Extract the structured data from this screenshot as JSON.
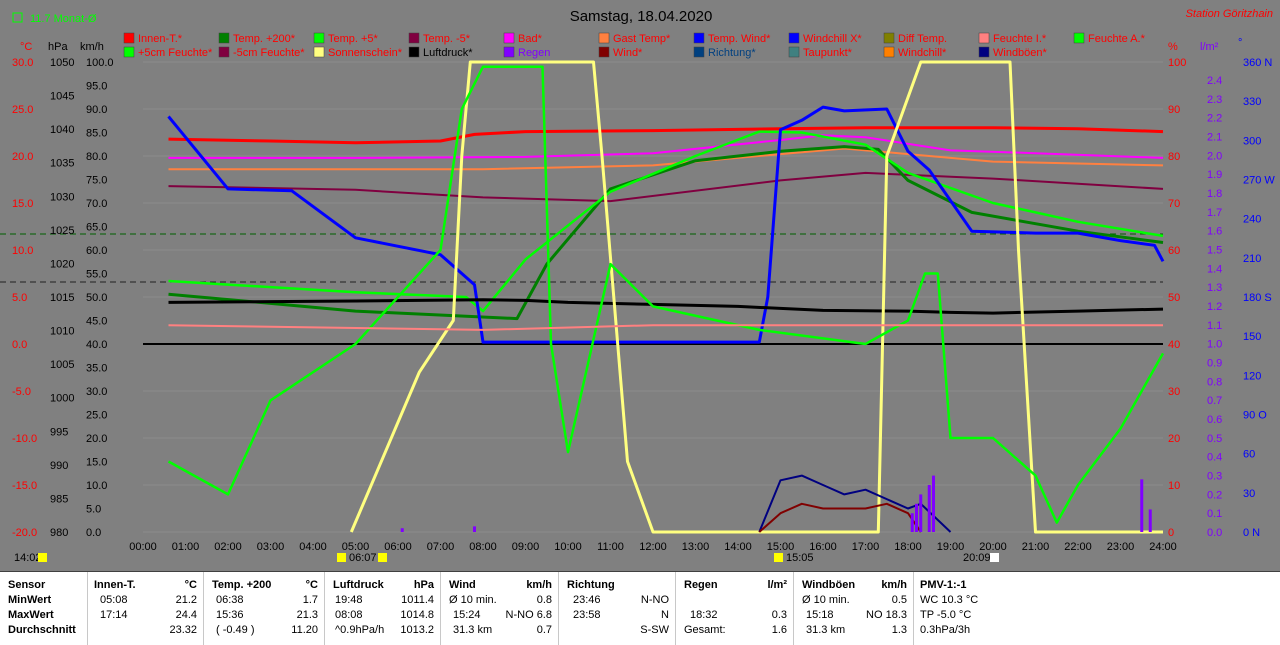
{
  "header": {
    "title": "Samstag, 18.04.2020",
    "station": "Station Göritzhain",
    "monat": "11.7 Monat-Ø"
  },
  "colors": {
    "background": "#808080",
    "innen": "#ff0000",
    "temp200": "#008000",
    "temp5": "#00ff00",
    "tempm5": "#800040",
    "bad": "#ff00ff",
    "gast": "#ff8040",
    "wind": "#0000ff",
    "luftdruck": "#000000",
    "sonne": "#ffff80",
    "regen": "#8000ff",
    "feuchteI": "#ff8080",
    "diff": "#808000",
    "taupunkt": "#408080"
  },
  "legend": [
    {
      "label": "Innen-T.*",
      "color": "#ff0000",
      "text_color": "#ff0000"
    },
    {
      "label": "Temp. +200*",
      "color": "#008000",
      "text_color": "#ff0000"
    },
    {
      "label": "Temp. +5*",
      "color": "#00ff00",
      "text_color": "#ff0000"
    },
    {
      "label": "Temp. -5*",
      "color": "#800040",
      "text_color": "#ff0000"
    },
    {
      "label": "Bad*",
      "color": "#ff00ff",
      "text_color": "#ff0000"
    },
    {
      "label": "Gast Temp*",
      "color": "#ff8040",
      "text_color": "#ff0000"
    },
    {
      "label": "Temp. Wind*",
      "color": "#0000ff",
      "text_color": "#ff0000"
    },
    {
      "label": "Windchill X*",
      "color": "#0000ff",
      "text_color": "#ff0000"
    },
    {
      "label": "Diff Temp.",
      "color": "#808000",
      "text_color": "#ff0000"
    },
    {
      "label": "Feuchte I.*",
      "color": "#ff8080",
      "text_color": "#ff0000"
    },
    {
      "label": "Feuchte A.*",
      "color": "#00ff00",
      "text_color": "#ff0000"
    },
    {
      "label": "+5cm Feuchte*",
      "color": "#00ff00",
      "text_color": "#ff0000"
    },
    {
      "label": "-5cm Feuchte*",
      "color": "#800040",
      "text_color": "#ff0000"
    },
    {
      "label": "Sonnenschein*",
      "color": "#ffff80",
      "text_color": "#ff0000"
    },
    {
      "label": "Luftdruck*",
      "color": "#000000",
      "text_color": "#000000"
    },
    {
      "label": "Regen",
      "color": "#8000ff",
      "text_color": "#8000ff"
    },
    {
      "label": "Wind*",
      "color": "#800000",
      "text_color": "#ff0000"
    },
    {
      "label": "Richtung*",
      "color": "#004080",
      "text_color": "#004080"
    },
    {
      "label": "Taupunkt*",
      "color": "#408080",
      "text_color": "#ff0000"
    },
    {
      "label": "Windchill*",
      "color": "#ff8000",
      "text_color": "#ff0000"
    },
    {
      "label": "Windböen*",
      "color": "#000080",
      "text_color": "#ff0000"
    }
  ],
  "axes": {
    "units": {
      "c": "°C",
      "hpa": "hPa",
      "kmh": "km/h",
      "pct": "%",
      "lm2": "l/m²",
      "deg": "°"
    },
    "c_ticks": [
      "30.0",
      "25.0",
      "20.0",
      "15.0",
      "10.0",
      "5.0",
      "0.0",
      "-5.0",
      "-10.0",
      "-15.0",
      "-20.0"
    ],
    "hpa_ticks": [
      "1050",
      "1045",
      "1040",
      "1035",
      "1030",
      "1025",
      "1020",
      "1015",
      "1010",
      "1005",
      "1000",
      "995",
      "990",
      "985",
      "980"
    ],
    "kmh_ticks": [
      "100.0",
      "95.0",
      "90.0",
      "85.0",
      "80.0",
      "75.0",
      "70.0",
      "65.0",
      "60.0",
      "55.0",
      "50.0",
      "45.0",
      "40.0",
      "35.0",
      "30.0",
      "25.0",
      "20.0",
      "15.0",
      "10.0",
      "5.0",
      "0.0"
    ],
    "pct_ticks": [
      "100",
      "90",
      "80",
      "70",
      "60",
      "50",
      "40",
      "30",
      "20",
      "10",
      "0"
    ],
    "lm2_ticks": [
      "2.4",
      "2.3",
      "2.2",
      "2.1",
      "2.0",
      "1.9",
      "1.8",
      "1.7",
      "1.6",
      "1.5",
      "1.4",
      "1.3",
      "1.2",
      "1.1",
      "1.0",
      "0.9",
      "0.8",
      "0.7",
      "0.6",
      "0.5",
      "0.4",
      "0.3",
      "0.2",
      "0.1",
      "0.0"
    ],
    "deg_ticks": [
      "360 N",
      "330",
      "300",
      "270 W",
      "240",
      "210",
      "180 S",
      "150",
      "120",
      "90 O",
      "60",
      "30",
      "0 N"
    ],
    "x_ticks": [
      "00:00",
      "01:00",
      "02:00",
      "03:00",
      "04:00",
      "05:00",
      "06:00",
      "07:00",
      "08:00",
      "09:00",
      "10:00",
      "11:00",
      "12:00",
      "13:00",
      "14:00",
      "15:00",
      "16:00",
      "17:00",
      "18:00",
      "19:00",
      "20:00",
      "21:00",
      "22:00",
      "23:00",
      "24:00"
    ],
    "marker_times": [
      "14:02",
      "06:07",
      "15:05",
      "20:09"
    ]
  },
  "chart_data": {
    "type": "line",
    "title": "Samstag, 18.04.2020",
    "x_range": [
      "00:00",
      "24:00"
    ],
    "y_ranges": {
      "temperature_c": [
        -20,
        30
      ],
      "pressure_hpa": [
        980,
        1050
      ],
      "wind_kmh": [
        0,
        100
      ],
      "humidity_pct": [
        0,
        100
      ],
      "rain_lm2": [
        0,
        2.5
      ],
      "direction_deg": [
        0,
        360
      ]
    },
    "series": [
      {
        "name": "Innen-T.*",
        "axis": "temperature_c",
        "color": "#ff0000",
        "x": [
          0.6,
          3,
          5,
          7,
          7.8,
          9,
          12,
          15,
          17,
          18,
          20,
          22,
          24
        ],
        "y": [
          21.8,
          21.6,
          21.4,
          21.6,
          22.3,
          22.6,
          22.7,
          22.9,
          23.0,
          23.0,
          23.0,
          22.9,
          22.6
        ]
      },
      {
        "name": "Bad*",
        "axis": "temperature_c",
        "color": "#ff00ff",
        "x": [
          0.6,
          5,
          9,
          12,
          15,
          16,
          17,
          19,
          21,
          24
        ],
        "y": [
          19.8,
          19.8,
          19.9,
          20.3,
          21.7,
          22.2,
          22.0,
          20.6,
          20.3,
          19.8
        ]
      },
      {
        "name": "Gast Temp*",
        "axis": "temperature_c",
        "color": "#ff8040",
        "x": [
          0.6,
          8,
          12,
          15,
          16.5,
          18,
          20,
          24
        ],
        "y": [
          18.6,
          18.6,
          19.0,
          20.2,
          20.8,
          20.2,
          19.4,
          19.0
        ]
      },
      {
        "name": "Temp. -5*",
        "axis": "temperature_c",
        "color": "#800040",
        "x": [
          0.6,
          5,
          8,
          11,
          15,
          17,
          20,
          24
        ],
        "y": [
          16.8,
          16.4,
          15.6,
          15.2,
          17.4,
          18.2,
          17.6,
          16.5
        ]
      },
      {
        "name": "Temp. +200*",
        "axis": "temperature_c",
        "color": "#008000",
        "x": [
          0.6,
          5,
          8.8,
          9.5,
          11,
          13,
          15,
          16.5,
          17.3,
          18,
          19.5,
          22,
          24
        ],
        "y": [
          5.3,
          3.5,
          2.7,
          8.5,
          16.5,
          19.5,
          20.5,
          21.0,
          20.7,
          17.4,
          14.0,
          12.0,
          10.8
        ]
      },
      {
        "name": "Temp. +5*",
        "axis": "temperature_c",
        "color": "#00ff00",
        "x": [
          0.6,
          5,
          7.6,
          8,
          9,
          11,
          13,
          14.5,
          15.5,
          17,
          18,
          20,
          22,
          24
        ],
        "y": [
          6.7,
          5.5,
          5.0,
          3.5,
          9,
          16.2,
          20,
          22.6,
          22.5,
          21.2,
          18.2,
          15,
          13,
          11.5
        ]
      },
      {
        "name": "Temp. Wind*",
        "axis": "temperature_c",
        "color": "#0000ff",
        "x": [
          0.6,
          2,
          3.5,
          5,
          7,
          7.8,
          8,
          14.5,
          14.7,
          15,
          15.5,
          16,
          16.5,
          17.5,
          18,
          18.5,
          19.5,
          21,
          22,
          23,
          23.8,
          24
        ],
        "y": [
          24.2,
          16.5,
          16.3,
          11.3,
          9.5,
          6.3,
          0.2,
          0.2,
          5,
          22.8,
          23.8,
          25.2,
          24.8,
          25.0,
          20.5,
          18.5,
          12.0,
          11.8,
          11.8,
          11.0,
          10.5,
          8.8
        ]
      },
      {
        "name": "Luftdruck*",
        "axis": "pressure_hpa",
        "color": "#000000",
        "x": [
          0.6,
          5,
          8,
          9,
          10,
          12,
          14,
          15,
          16,
          18,
          19,
          20,
          22,
          24
        ],
        "y": [
          1014.2,
          1014.4,
          1014.6,
          1014.5,
          1014.2,
          1013.9,
          1013.6,
          1013.3,
          1013.0,
          1012.9,
          1012.7,
          1012.6,
          1012.9,
          1013.2
        ]
      },
      {
        "name": "Sonnenschein*",
        "axis": "humidity_pct",
        "color": "#ffff80",
        "x": [
          4.9,
          6.5,
          7.3,
          7.5,
          7.7,
          10.6,
          10.8,
          11.4,
          12,
          17.3,
          17.5,
          18.3,
          20.4,
          20.6,
          21,
          24
        ],
        "y": [
          0,
          34,
          45,
          80,
          100,
          100,
          80,
          15,
          0,
          0,
          80,
          100,
          100,
          60,
          0,
          0
        ]
      },
      {
        "name": "Feuchte A.*",
        "axis": "humidity_pct",
        "color": "#00ff00",
        "x": [
          0.6,
          2,
          3,
          5,
          7,
          7.5,
          8,
          9.4,
          9.6,
          10,
          11,
          12,
          14.5,
          17,
          18,
          18.4,
          18.7,
          19,
          20,
          21,
          21.5,
          22,
          23,
          24
        ],
        "y": [
          15,
          8,
          28,
          40,
          60,
          90,
          99,
          99,
          40,
          17,
          57,
          48,
          43,
          40,
          45,
          55,
          55,
          20,
          20,
          12,
          2,
          10,
          22,
          38
        ]
      },
      {
        "name": "Feuchte I.*",
        "axis": "humidity_pct",
        "color": "#ff8080",
        "x": [
          0.6,
          8,
          12,
          16,
          20,
          24
        ],
        "y": [
          44,
          43,
          44,
          44,
          44,
          44
        ]
      },
      {
        "name": "Windböen*",
        "axis": "wind_kmh",
        "color": "#000080",
        "x": [
          14.5,
          15,
          15.5,
          16,
          16.5,
          17,
          18,
          18.3,
          19
        ],
        "y": [
          0,
          11,
          12,
          10,
          8,
          9,
          5,
          6,
          0
        ]
      },
      {
        "name": "Wind*",
        "axis": "wind_kmh",
        "color": "#800000",
        "x": [
          14.5,
          15,
          15.5,
          16,
          17,
          17.5,
          18,
          18.3
        ],
        "y": [
          0,
          4,
          6,
          5,
          5,
          6,
          4,
          0
        ]
      }
    ],
    "rain_bars": {
      "name": "Regen",
      "axis": "rain_lm2",
      "x": [
        6.1,
        7.8,
        18.1,
        18.2,
        18.3,
        18.5,
        18.6,
        23.5,
        23.7
      ],
      "y": [
        0.02,
        0.03,
        0.1,
        0.15,
        0.2,
        0.25,
        0.3,
        0.28,
        0.12
      ]
    }
  },
  "stats": {
    "sensor": {
      "header": "Sensor",
      "rows": [
        "MinWert",
        "MaxWert",
        "Durchschnitt"
      ]
    },
    "innen": {
      "header": "Innen-T.",
      "unit": "°C",
      "rows": [
        [
          "05:08",
          "21.2"
        ],
        [
          "17:14",
          "24.4"
        ],
        [
          "",
          "23.32"
        ]
      ]
    },
    "temp200": {
      "header": "Temp. +200",
      "unit": "°C",
      "rows": [
        [
          "06:38",
          "1.7"
        ],
        [
          "15:36",
          "21.3"
        ],
        [
          "( -0.49 )",
          "11.20"
        ]
      ]
    },
    "luft": {
      "header": "Luftdruck",
      "unit": "hPa",
      "rows": [
        [
          "19:48",
          "1011.4"
        ],
        [
          "08:08",
          "1014.8"
        ],
        [
          "^0.9hPa/h",
          "1013.2"
        ]
      ]
    },
    "wind": {
      "header": "Wind",
      "unit": "km/h",
      "rows": [
        [
          "Ø 10 min.",
          "0.8"
        ],
        [
          "15:24",
          "N-NO 6.8"
        ],
        [
          "31.3 km",
          "0.7"
        ]
      ]
    },
    "richtung": {
      "header": "Richtung",
      "unit": "",
      "rows": [
        [
          "23:46",
          "N-NO"
        ],
        [
          "23:58",
          "N"
        ],
        [
          "",
          "S-SW"
        ]
      ]
    },
    "regen": {
      "header": "Regen",
      "unit": "l/m²",
      "rows": [
        [
          "",
          ""
        ],
        [
          "18:32",
          "0.3"
        ],
        [
          "Gesamt:",
          "1.6"
        ]
      ]
    },
    "boeen": {
      "header": "Windböen",
      "unit": "km/h",
      "rows": [
        [
          "Ø 10 min.",
          "0.5"
        ],
        [
          "15:18",
          "NO 18.3"
        ],
        [
          "31.3 km",
          "1.3"
        ]
      ]
    },
    "pmv": {
      "header": "PMV-1:-1",
      "rows": [
        "WC 10.3 °C",
        "TP -5.0 °C",
        "0.3hPa/3h"
      ]
    }
  }
}
